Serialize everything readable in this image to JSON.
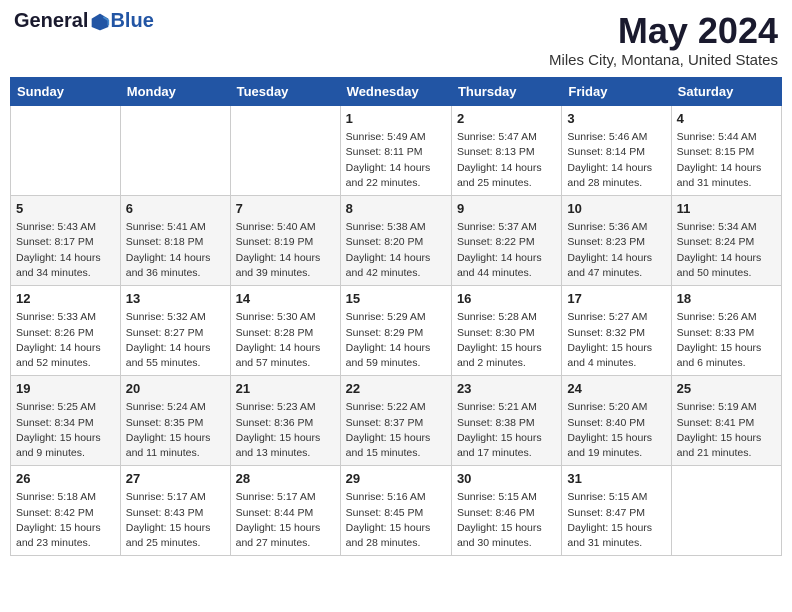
{
  "logo": {
    "general": "General",
    "blue": "Blue"
  },
  "title": "May 2024",
  "location": "Miles City, Montana, United States",
  "weekdays": [
    "Sunday",
    "Monday",
    "Tuesday",
    "Wednesday",
    "Thursday",
    "Friday",
    "Saturday"
  ],
  "weeks": [
    [
      {
        "day": "",
        "info": ""
      },
      {
        "day": "",
        "info": ""
      },
      {
        "day": "",
        "info": ""
      },
      {
        "day": "1",
        "info": "Sunrise: 5:49 AM\nSunset: 8:11 PM\nDaylight: 14 hours\nand 22 minutes."
      },
      {
        "day": "2",
        "info": "Sunrise: 5:47 AM\nSunset: 8:13 PM\nDaylight: 14 hours\nand 25 minutes."
      },
      {
        "day": "3",
        "info": "Sunrise: 5:46 AM\nSunset: 8:14 PM\nDaylight: 14 hours\nand 28 minutes."
      },
      {
        "day": "4",
        "info": "Sunrise: 5:44 AM\nSunset: 8:15 PM\nDaylight: 14 hours\nand 31 minutes."
      }
    ],
    [
      {
        "day": "5",
        "info": "Sunrise: 5:43 AM\nSunset: 8:17 PM\nDaylight: 14 hours\nand 34 minutes."
      },
      {
        "day": "6",
        "info": "Sunrise: 5:41 AM\nSunset: 8:18 PM\nDaylight: 14 hours\nand 36 minutes."
      },
      {
        "day": "7",
        "info": "Sunrise: 5:40 AM\nSunset: 8:19 PM\nDaylight: 14 hours\nand 39 minutes."
      },
      {
        "day": "8",
        "info": "Sunrise: 5:38 AM\nSunset: 8:20 PM\nDaylight: 14 hours\nand 42 minutes."
      },
      {
        "day": "9",
        "info": "Sunrise: 5:37 AM\nSunset: 8:22 PM\nDaylight: 14 hours\nand 44 minutes."
      },
      {
        "day": "10",
        "info": "Sunrise: 5:36 AM\nSunset: 8:23 PM\nDaylight: 14 hours\nand 47 minutes."
      },
      {
        "day": "11",
        "info": "Sunrise: 5:34 AM\nSunset: 8:24 PM\nDaylight: 14 hours\nand 50 minutes."
      }
    ],
    [
      {
        "day": "12",
        "info": "Sunrise: 5:33 AM\nSunset: 8:26 PM\nDaylight: 14 hours\nand 52 minutes."
      },
      {
        "day": "13",
        "info": "Sunrise: 5:32 AM\nSunset: 8:27 PM\nDaylight: 14 hours\nand 55 minutes."
      },
      {
        "day": "14",
        "info": "Sunrise: 5:30 AM\nSunset: 8:28 PM\nDaylight: 14 hours\nand 57 minutes."
      },
      {
        "day": "15",
        "info": "Sunrise: 5:29 AM\nSunset: 8:29 PM\nDaylight: 14 hours\nand 59 minutes."
      },
      {
        "day": "16",
        "info": "Sunrise: 5:28 AM\nSunset: 8:30 PM\nDaylight: 15 hours\nand 2 minutes."
      },
      {
        "day": "17",
        "info": "Sunrise: 5:27 AM\nSunset: 8:32 PM\nDaylight: 15 hours\nand 4 minutes."
      },
      {
        "day": "18",
        "info": "Sunrise: 5:26 AM\nSunset: 8:33 PM\nDaylight: 15 hours\nand 6 minutes."
      }
    ],
    [
      {
        "day": "19",
        "info": "Sunrise: 5:25 AM\nSunset: 8:34 PM\nDaylight: 15 hours\nand 9 minutes."
      },
      {
        "day": "20",
        "info": "Sunrise: 5:24 AM\nSunset: 8:35 PM\nDaylight: 15 hours\nand 11 minutes."
      },
      {
        "day": "21",
        "info": "Sunrise: 5:23 AM\nSunset: 8:36 PM\nDaylight: 15 hours\nand 13 minutes."
      },
      {
        "day": "22",
        "info": "Sunrise: 5:22 AM\nSunset: 8:37 PM\nDaylight: 15 hours\nand 15 minutes."
      },
      {
        "day": "23",
        "info": "Sunrise: 5:21 AM\nSunset: 8:38 PM\nDaylight: 15 hours\nand 17 minutes."
      },
      {
        "day": "24",
        "info": "Sunrise: 5:20 AM\nSunset: 8:40 PM\nDaylight: 15 hours\nand 19 minutes."
      },
      {
        "day": "25",
        "info": "Sunrise: 5:19 AM\nSunset: 8:41 PM\nDaylight: 15 hours\nand 21 minutes."
      }
    ],
    [
      {
        "day": "26",
        "info": "Sunrise: 5:18 AM\nSunset: 8:42 PM\nDaylight: 15 hours\nand 23 minutes."
      },
      {
        "day": "27",
        "info": "Sunrise: 5:17 AM\nSunset: 8:43 PM\nDaylight: 15 hours\nand 25 minutes."
      },
      {
        "day": "28",
        "info": "Sunrise: 5:17 AM\nSunset: 8:44 PM\nDaylight: 15 hours\nand 27 minutes."
      },
      {
        "day": "29",
        "info": "Sunrise: 5:16 AM\nSunset: 8:45 PM\nDaylight: 15 hours\nand 28 minutes."
      },
      {
        "day": "30",
        "info": "Sunrise: 5:15 AM\nSunset: 8:46 PM\nDaylight: 15 hours\nand 30 minutes."
      },
      {
        "day": "31",
        "info": "Sunrise: 5:15 AM\nSunset: 8:47 PM\nDaylight: 15 hours\nand 31 minutes."
      },
      {
        "day": "",
        "info": ""
      }
    ]
  ]
}
